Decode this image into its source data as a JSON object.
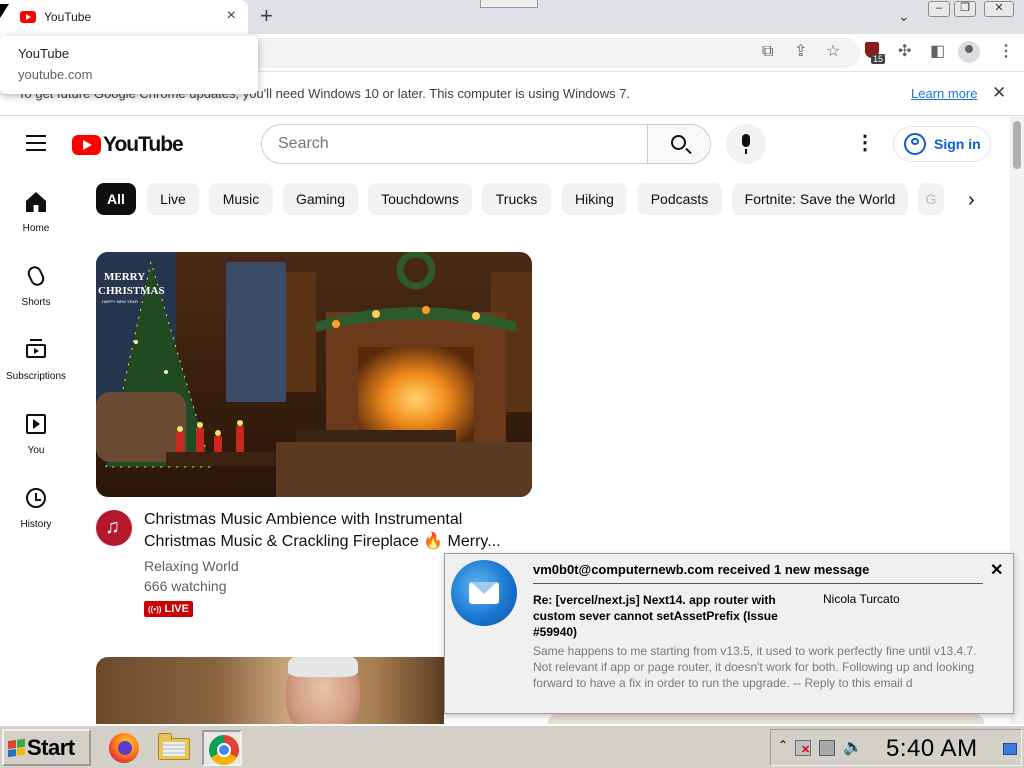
{
  "browser": {
    "tab_title": "YouTube",
    "tab_close": "×",
    "new_tab": "+",
    "tab_search": "⌄",
    "window_buttons": [
      "–",
      "❐",
      "✕"
    ],
    "hover_card": {
      "title": "YouTube",
      "domain": "youtube.com"
    },
    "extension_badge": "15",
    "infobar": {
      "message": "To get future Google Chrome updates, you'll need Windows 10 or later. This computer is using Windows 7.",
      "link": "Learn more",
      "close": "✕"
    }
  },
  "youtube": {
    "logo_text": "YouTube",
    "search_placeholder": "Search",
    "kebab": "⋮",
    "signin_label": "Sign in",
    "chips": [
      "All",
      "Live",
      "Music",
      "Gaming",
      "Touchdowns",
      "Trucks",
      "Hiking",
      "Podcasts",
      "Fortnite: Save the World",
      "G"
    ],
    "chips_next": "›",
    "guide": [
      {
        "label": "Home",
        "icon": "home-icon"
      },
      {
        "label": "Shorts",
        "icon": "shorts-icon"
      },
      {
        "label": "Subscriptions",
        "icon": "subscriptions-icon"
      },
      {
        "label": "You",
        "icon": "you-icon"
      },
      {
        "label": "History",
        "icon": "history-icon"
      }
    ],
    "video": {
      "thumbnail_text_1": "MERRY",
      "thumbnail_text_2": "CHRISTMAS",
      "thumbnail_text_3": "HAPPY NEW YEAR",
      "title_line1": "Christmas Music Ambience with Instrumental",
      "title_line2": "Christmas Music & Crackling Fireplace 🔥 Merry...",
      "channel": "Relaxing World",
      "watching": "666 watching",
      "live_label": "LIVE",
      "live_icon": "((•))"
    }
  },
  "notification": {
    "header": "vm0b0t@computernewb.com received 1 new message",
    "close": "✕",
    "subject": "Re: [vercel/next.js] Next14. app router with custom sever cannot setAssetPrefix (Issue #59940)",
    "sender": "Nicola Turcato",
    "preview": "Same happens to me starting from v13.5, it used to work perfectly fine until v13.4.7. Not relevant if app or page router, it doesn't work for both. Following up and looking forward to have a fix in order to run the upgrade. -- Reply to this email d"
  },
  "taskbar": {
    "start_label": "Start",
    "tray_arrow": "⌃",
    "clock": "5:40 AM"
  },
  "colors": {
    "youtube_red": "#ff0000",
    "link_blue": "#065fd4",
    "chip_active": "#0f0f0f",
    "live_red": "#cc0000",
    "taskbar_gray": "#d4d0c8"
  }
}
